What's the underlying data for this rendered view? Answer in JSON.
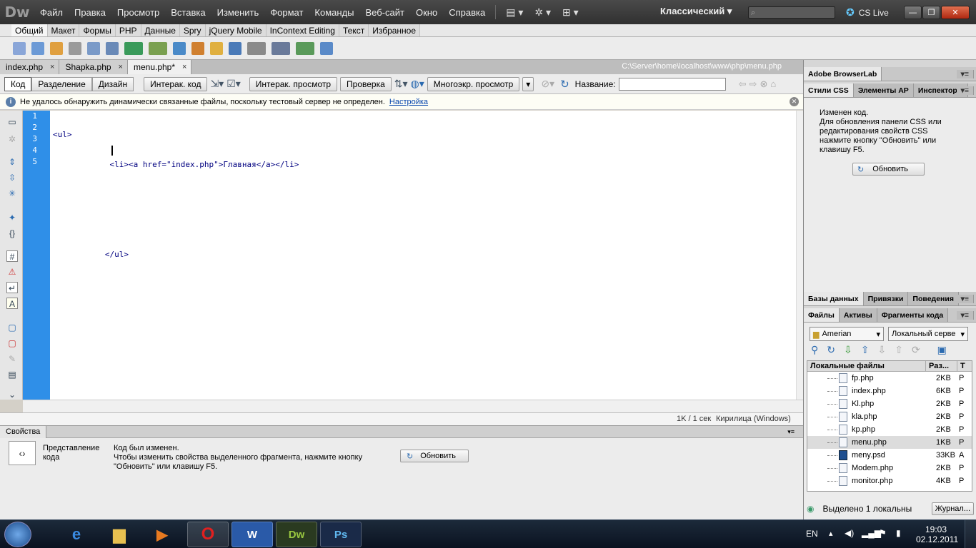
{
  "app": {
    "logo": "Dw",
    "workspace": "Классический",
    "cslive": "CS Live"
  },
  "menu": [
    "Файл",
    "Правка",
    "Просмотр",
    "Вставка",
    "Изменить",
    "Формат",
    "Команды",
    "Веб-сайт",
    "Окно",
    "Справка"
  ],
  "insert_tabs": [
    "Общий",
    "Макет",
    "Формы",
    "PHP",
    "Данные",
    "Spry",
    "jQuery Mobile",
    "InContext Editing",
    "Текст",
    "Избранное"
  ],
  "doc_tabs": [
    {
      "name": "index.php",
      "close": "×"
    },
    {
      "name": "Shapka.php",
      "close": "×"
    },
    {
      "name": "menu.php*",
      "close": "×"
    }
  ],
  "doc_path": "C:\\Server\\home\\localhost\\www\\php\\menu.php",
  "doc_toolbar": {
    "code": "Код",
    "split": "Разделение",
    "design": "Дизайн",
    "live_code": "Интерак. код",
    "live_view": "Интерак. просмотр",
    "check": "Проверка",
    "multiscreen": "Многоэкр. просмотр",
    "title_label": "Название:",
    "title_value": ""
  },
  "info_bar": {
    "message": "Не удалось обнаружить динамически связанные файлы, поскольку тестовый сервер не определен.",
    "link": "Настройка"
  },
  "code": {
    "line_numbers": [
      "1",
      "2",
      "3",
      "4",
      "5"
    ],
    "lines": [
      "<ul>",
      "            <li><a href=\"index.php\">Главная</a></li>",
      "",
      "",
      "           </ul>"
    ]
  },
  "status": {
    "size": "1K / 1 сек",
    "encoding": "Кирилица (Windows)"
  },
  "properties": {
    "title": "Свойства",
    "label": "Представление кода",
    "message_line1": "Код был изменен.",
    "message_line2": "Чтобы изменить свойства выделенного фрагмента, нажмите кнопку",
    "message_line3": "\"Обновить\" или клавишу F5.",
    "refresh": "Обновить"
  },
  "right": {
    "browserlab": "Adobe BrowserLab",
    "css_tabs": [
      "Стили CSS",
      "Элементы AP",
      "Инспектор т"
    ],
    "css_message": [
      "Изменен код.",
      "Для обновления панели CSS или",
      "редактирования свойств CSS",
      "нажмите кнопку \"Обновить\" или",
      "клавишу F5."
    ],
    "css_refresh": "Обновить",
    "db_tabs": [
      "Базы данных",
      "Привязки",
      "Поведения"
    ],
    "file_tabs": [
      "Файлы",
      "Активы",
      "Фрагменты кода"
    ],
    "site": "Amerian",
    "server": "Локальный серве",
    "columns": [
      "Локальные файлы",
      "Раз...",
      "Т"
    ],
    "files": [
      {
        "name": "fp.php",
        "size": "2KB",
        "type": "P"
      },
      {
        "name": "index.php",
        "size": "6KB",
        "type": "P"
      },
      {
        "name": "Kl.php",
        "size": "2KB",
        "type": "P"
      },
      {
        "name": "kla.php",
        "size": "2KB",
        "type": "P"
      },
      {
        "name": "kp.php",
        "size": "2KB",
        "type": "P"
      },
      {
        "name": "menu.php",
        "size": "1KB",
        "type": "P"
      },
      {
        "name": "meny.psd",
        "size": "33KB",
        "type": "A"
      },
      {
        "name": "Modem.php",
        "size": "2KB",
        "type": "P"
      },
      {
        "name": "monitor.php",
        "size": "4KB",
        "type": "P"
      }
    ],
    "files_status": "Выделено 1 локальны",
    "log": "Журнал..."
  },
  "taskbar": {
    "lang": "EN",
    "time": "19:03",
    "date": "02.12.2011",
    "apps": [
      "",
      "",
      "",
      "",
      "",
      "Dw",
      "Ps"
    ]
  },
  "colors": {
    "gutter": "#2f8fe8",
    "titlebar": "#3a3a3a"
  }
}
